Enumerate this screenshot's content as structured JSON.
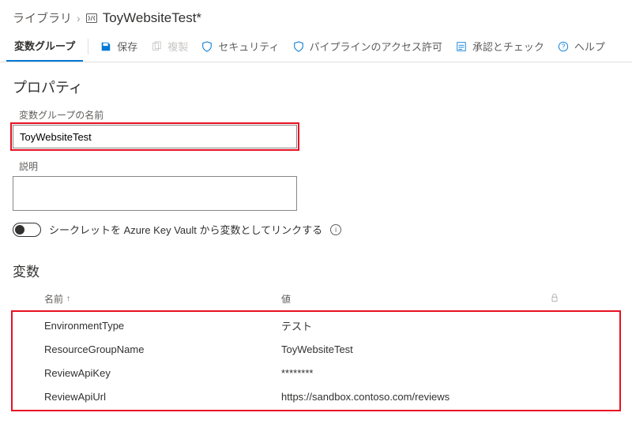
{
  "breadcrumb": {
    "root": "ライブラリ",
    "title": "ToyWebsiteTest*"
  },
  "tabs": {
    "varGroup": "変数グループ"
  },
  "toolbar": {
    "save": "保存",
    "clone": "複製",
    "security": "セキュリティ",
    "pipeline": "パイプラインのアクセス許可",
    "approvals": "承認とチェック",
    "help": "ヘルプ"
  },
  "properties": {
    "heading": "プロパティ",
    "nameLabel": "変数グループの名前",
    "nameValue": "ToyWebsiteTest",
    "descLabel": "説明",
    "descValue": "",
    "kvToggleLabel": "シークレットを Azure Key Vault から変数としてリンクする"
  },
  "variables": {
    "heading": "変数",
    "col_name": "名前",
    "col_value": "値",
    "rows": [
      {
        "name": "EnvironmentType",
        "value": "テスト"
      },
      {
        "name": "ResourceGroupName",
        "value": "ToyWebsiteTest"
      },
      {
        "name": "ReviewApiKey",
        "value": "********"
      },
      {
        "name": "ReviewApiUrl",
        "value": "https://sandbox.contoso.com/reviews"
      }
    ]
  }
}
